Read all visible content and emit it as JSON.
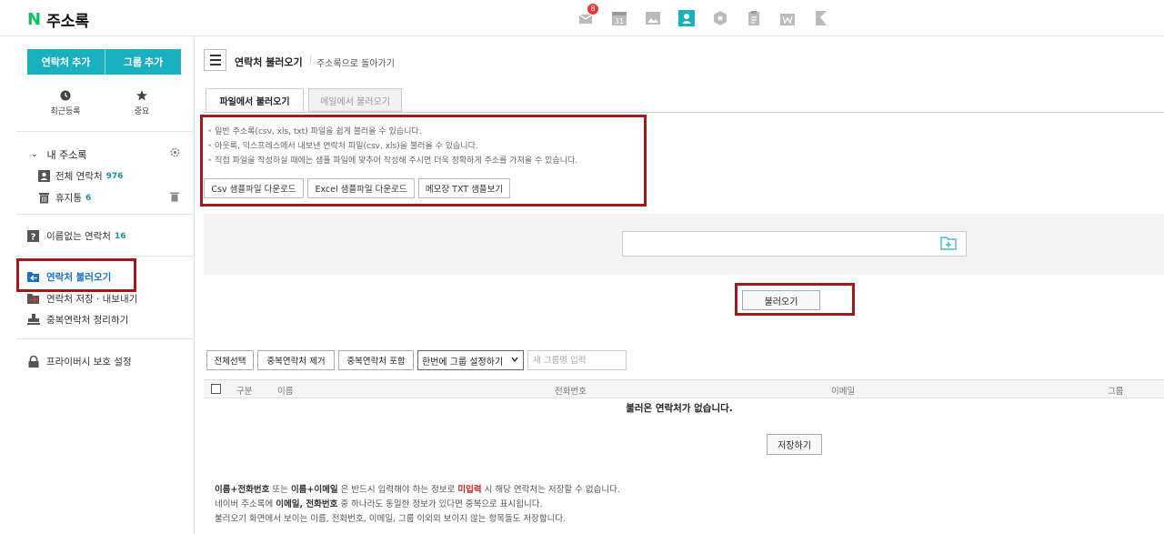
{
  "app": {
    "logo_n": "N",
    "title": "주소록",
    "mail_badge": "8",
    "calendar_label": "31"
  },
  "sidebar": {
    "add_contact": "연락처 추가",
    "add_group": "그룹 추가",
    "recent": "최근등록",
    "important": "중요",
    "my_addressbook": "내 주소록",
    "all_contacts": "전체 연락처",
    "all_contacts_count": "976",
    "trash": "휴지통",
    "trash_count": "6",
    "unnamed": "이름없는 연락처",
    "unnamed_count": "16",
    "import": "연락처 불러오기",
    "export": "연락처 저장 · 내보내기",
    "dedupe": "중복연락처 정리하기",
    "privacy": "프라이버시 보호 설정"
  },
  "main": {
    "title": "연락처 불러오기",
    "back": "주소록으로 돌아가기",
    "tabs": [
      {
        "label": "파일에서 불러오기"
      },
      {
        "label": "메일에서 불러오기"
      }
    ],
    "notes": [
      "일반 주소록(csv, xls, txt) 파일을 쉽게 불러올 수 있습니다.",
      "아웃룩, 익스프레스에서 내보낸 연락처 파일(csv, xls)을 불러올 수 있습니다.",
      "직접 파일을 작성하실 때에는 샘플 파일에 맞추어 작성해 주시면 더욱 정확하게 주소를 가져올 수 있습니다."
    ],
    "sample_buttons": [
      "Csv 샘플파일 다운로드",
      "Excel 샘플파일 다운로드",
      "메모장 TXT 샘플보기"
    ],
    "load_button": "불러오기",
    "actions": {
      "select_all": "전체선택",
      "remove_dup": "중복연락처 제거",
      "include_dup": "중복연락처 포함",
      "group_select": "한번에 그룹 설정하기",
      "group_placeholder": "새 그룹명 입력"
    },
    "columns": {
      "type": "구분",
      "name": "이름",
      "phone": "전화번호",
      "email": "이메일",
      "group": "그룹"
    },
    "empty": "불러온 연락처가 없습니다.",
    "save_button": "저장하기",
    "footnotes": {
      "l1_a": "이름+전화번호",
      "l1_b": " 또는 ",
      "l1_c": "이름+이메일",
      "l1_d": " 은 반드시 입력해야 하는 정보로 ",
      "l1_e": "미입력",
      "l1_f": " 시 해당 연락처는 저장할 수 없습니다.",
      "l2_a": "네이버 주소록에 ",
      "l2_b": "이메일, 전화번호",
      "l2_c": " 중 하나라도 동일한 정보가 있다면 중복으로 표시됩니다.",
      "l3": "불러오기 화면에서 보이는 이름, 전화번호, 이메일, 그룹 이외의 보이지 않는 항목들도 저장합니다."
    }
  },
  "colors": {
    "accent": "#19b0c0",
    "brand_green": "#03c75a",
    "highlight_box": "#a31818",
    "active_link": "#1570c8"
  }
}
